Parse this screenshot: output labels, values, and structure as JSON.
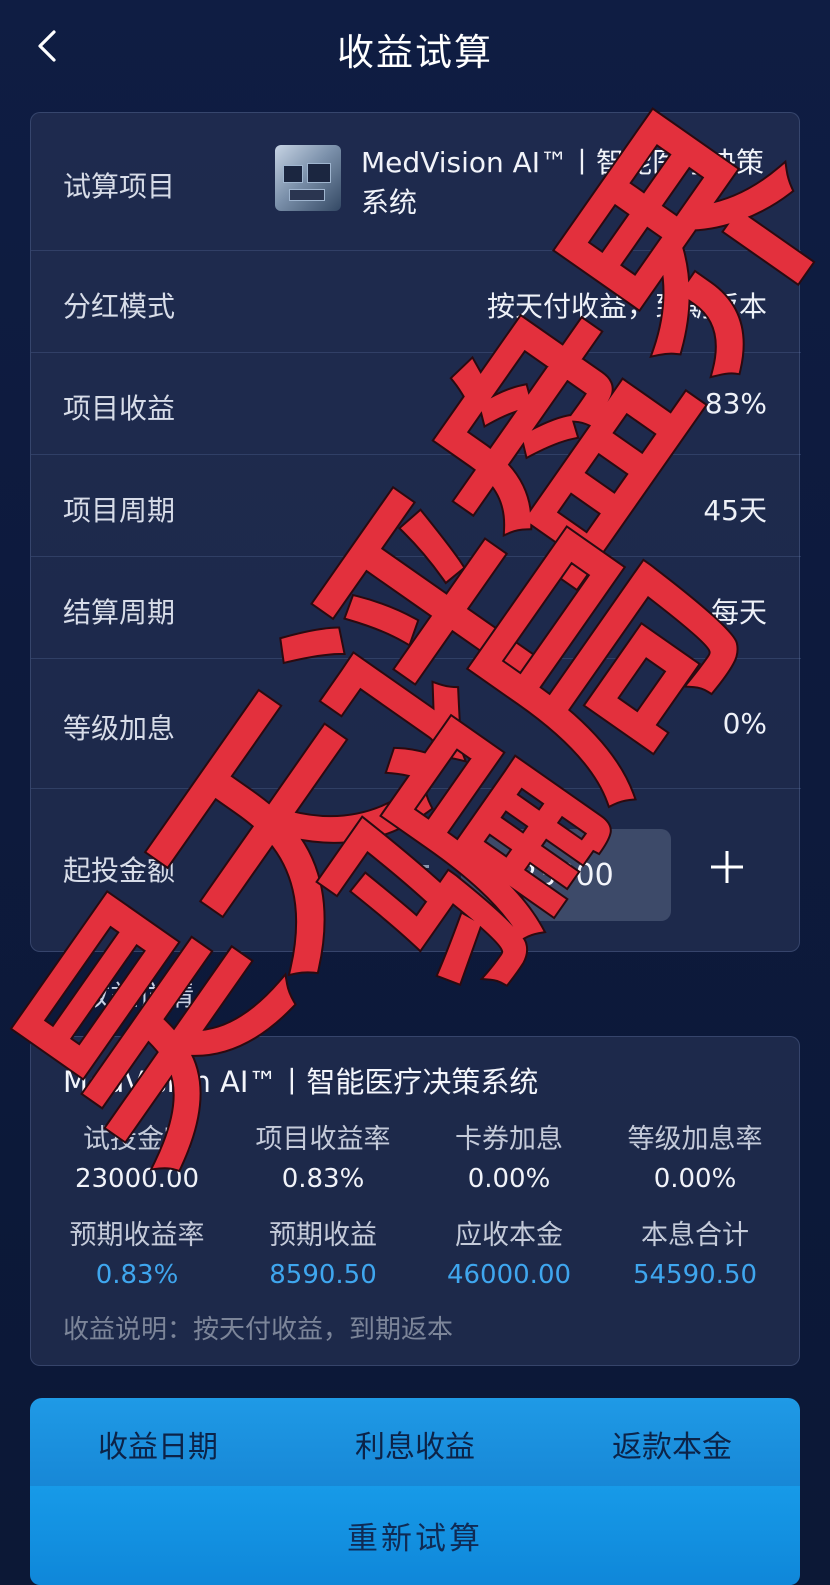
{
  "header": {
    "title": "收益试算",
    "back_icon": "chevron-left-icon"
  },
  "form": {
    "project": {
      "label": "试算项目",
      "name": "MedVision AI™丨智能医疗决策系统"
    },
    "dividend_mode": {
      "label": "分红模式",
      "value": "按天付收益，到期返本"
    },
    "project_yield": {
      "label": "项目收益",
      "value": "0.83%"
    },
    "project_period": {
      "label": "项目周期",
      "value": "45天"
    },
    "settlement_period": {
      "label": "结算周期",
      "value": "每天"
    },
    "level_bonus": {
      "label": "等级加息",
      "value": "0%"
    },
    "min_amount": {
      "label": "起投金额",
      "value": "23000"
    }
  },
  "detail": {
    "section_title": "收益详情",
    "project_name": "MedVision AI™丨智能医疗决策系统",
    "row1": [
      {
        "label": "试投金额",
        "value": "23000.00"
      },
      {
        "label": "项目收益率",
        "value": "0.83%"
      },
      {
        "label": "卡券加息",
        "value": "0.00%"
      },
      {
        "label": "等级加息率",
        "value": "0.00%"
      }
    ],
    "row2": [
      {
        "label": "预期收益率",
        "value": "0.83%"
      },
      {
        "label": "预期收益",
        "value": "8590.50"
      },
      {
        "label": "应收本金",
        "value": "46000.00"
      },
      {
        "label": "本息合计",
        "value": "54590.50"
      }
    ],
    "note": "收益说明：按天付收益，到期返本"
  },
  "table": {
    "headers": [
      "收益日期",
      "利息收益",
      "返款本金"
    ]
  },
  "actions": {
    "recalc_label": "重新试算"
  },
  "watermark": {
    "line1": "昊天评盘界",
    "line2": "骗局",
    "color": "#e3303d"
  },
  "colors": {
    "accent": "#3fa6ee",
    "button": "#1787d6"
  }
}
